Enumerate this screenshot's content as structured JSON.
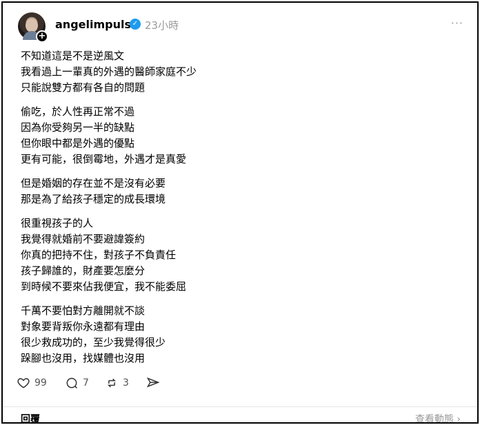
{
  "post": {
    "username": "angelimpulse",
    "timestamp": "23小時",
    "more_label": "···",
    "paragraphs": [
      [
        "不知道這是不是逆風文",
        "我看過上一輩真的外遇的醫師家庭不少",
        "只能說雙方都有各自的問題"
      ],
      [
        "偷吃，於人性再正常不過",
        "因為你受夠另一半的缺點",
        "但你眼中都是外遇的優點",
        "更有可能，很倒霉地，外遇才是真愛"
      ],
      [
        "但是婚姻的存在並不是沒有必要",
        "那是為了給孩子穩定的成長環境"
      ],
      [
        "很重視孩子的人",
        "我覺得就婚前不要避諱簽約",
        "你真的把持不住，對孩子不負責任",
        "孩子歸誰的，財產要怎麼分",
        "到時候不要來佔我便宜，我不能委屈"
      ],
      [
        "千萬不要怕對方離開就不談",
        "對象要背叛你永遠都有理由",
        "很少救成功的，至少我覺得很少",
        "跺腳也沒用，找媒體也沒用"
      ]
    ],
    "stats": {
      "likes": "99",
      "replies": "7",
      "reposts": "3"
    }
  },
  "footer": {
    "replies_label": "回覆",
    "view_activity_label": "查看動態 ›"
  },
  "icons": {
    "avatar_plus": "+",
    "verified": "✓"
  }
}
